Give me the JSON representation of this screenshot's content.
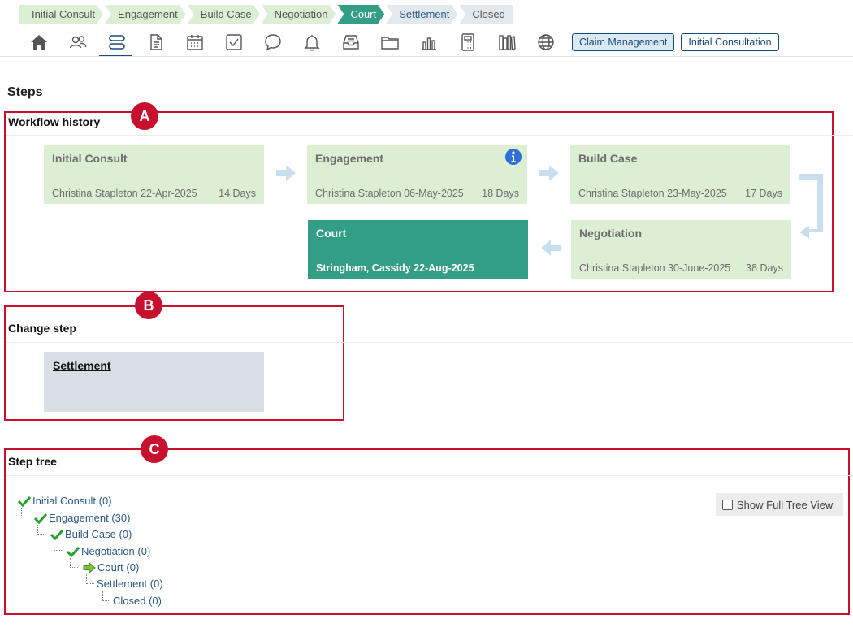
{
  "breadcrumb": [
    {
      "label": "Initial Consult",
      "state": "done"
    },
    {
      "label": "Engagement",
      "state": "done"
    },
    {
      "label": "Build Case",
      "state": "done"
    },
    {
      "label": "Negotiation",
      "state": "done"
    },
    {
      "label": "Court",
      "state": "current"
    },
    {
      "label": "Settlement",
      "state": "next"
    },
    {
      "label": "Closed",
      "state": "future"
    }
  ],
  "toolbar": {
    "icons": [
      "home-icon",
      "contacts-icon",
      "steps-icon",
      "document-icon",
      "calendar-icon",
      "task-icon",
      "chat-icon",
      "bell-icon",
      "inbox-icon",
      "folder-icon",
      "chart-icon",
      "calculator-icon",
      "library-icon",
      "globe-icon"
    ],
    "tags": [
      "Claim Management",
      "Initial Consultation"
    ]
  },
  "page": {
    "title": "Steps"
  },
  "annotations": {
    "a": "A",
    "b": "B",
    "c": "C"
  },
  "workflow_history": {
    "title": "Workflow history",
    "steps": [
      {
        "name": "Initial Consult",
        "user": "Christina Stapleton",
        "date": "22-Apr-2025",
        "duration": "14 Days"
      },
      {
        "name": "Engagement",
        "user": "Christina Stapleton",
        "date": "06-May-2025",
        "duration": "18 Days"
      },
      {
        "name": "Build Case",
        "user": "Christina Stapleton",
        "date": "23-May-2025",
        "duration": "17 Days"
      },
      {
        "name": "Negotiation",
        "user": "Christina Stapleton",
        "date": "30-June-2025",
        "duration": "38 Days"
      },
      {
        "name": "Court",
        "user": "Stringham, Cassidy",
        "date": "22-Aug-2025",
        "duration": ""
      }
    ]
  },
  "change_step": {
    "title": "Change step",
    "next_step": "Settlement"
  },
  "step_tree": {
    "title": "Step tree",
    "full_tree_label": "Show Full Tree View",
    "full_tree_checked": false,
    "nodes": [
      {
        "label": "Initial Consult (0)",
        "status": "done"
      },
      {
        "label": "Engagement (30)",
        "status": "done"
      },
      {
        "label": "Build Case (0)",
        "status": "done"
      },
      {
        "label": "Negotiation (0)",
        "status": "done"
      },
      {
        "label": "Court (0)",
        "status": "current"
      },
      {
        "label": "Settlement (0)",
        "status": "pending"
      },
      {
        "label": "Closed (0)",
        "status": "pending"
      }
    ]
  },
  "colors": {
    "done": "#dcefd4",
    "current": "#339e86",
    "annotation": "#c8102e",
    "link": "#2a5a85",
    "check": "#2ca02c"
  }
}
